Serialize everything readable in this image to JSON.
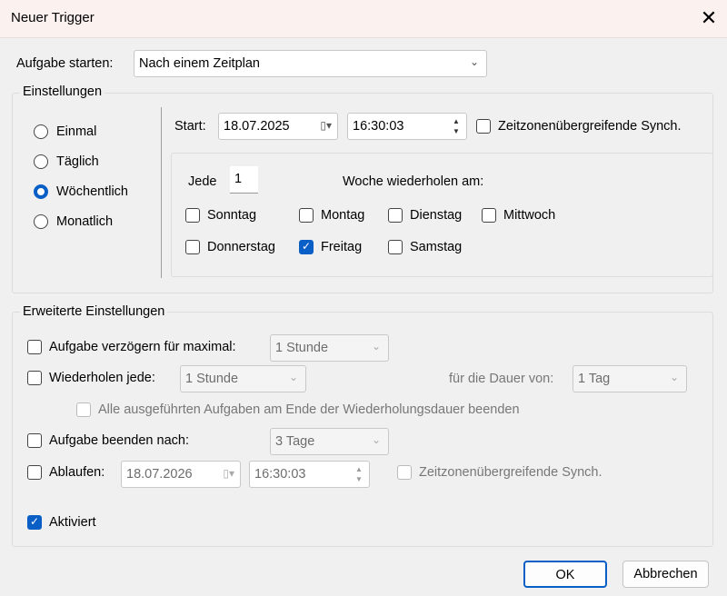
{
  "window": {
    "title": "Neuer Trigger",
    "close_icon": "close-icon"
  },
  "start_task": {
    "label": "Aufgabe starten:",
    "value": "Nach einem Zeitplan"
  },
  "settings": {
    "label": "Einstellungen",
    "schedules": [
      {
        "label": "Einmal",
        "selected": false
      },
      {
        "label": "Täglich",
        "selected": false
      },
      {
        "label": "Wöchentlich",
        "selected": true
      },
      {
        "label": "Monatlich",
        "selected": false
      }
    ],
    "start_label": "Start:",
    "start_date": "18.07.2025",
    "start_time": "16:30:03",
    "sync_label": "Zeitzonenübergreifende Synch.",
    "every_label": "Jede",
    "every_value": "1",
    "repeat_on_label": "Woche wiederholen am:",
    "days": [
      {
        "label": "Sonntag",
        "checked": false
      },
      {
        "label": "Montag",
        "checked": false
      },
      {
        "label": "Dienstag",
        "checked": false
      },
      {
        "label": "Mittwoch",
        "checked": false
      },
      {
        "label": "Donnerstag",
        "checked": false
      },
      {
        "label": "Freitag",
        "checked": true
      },
      {
        "label": "Samstag",
        "checked": false
      }
    ]
  },
  "advanced": {
    "label": "Erweiterte Einstellungen",
    "delay_label": "Aufgabe verzögern für maximal:",
    "delay_value": "1 Stunde",
    "repeat_label": "Wiederholen jede:",
    "repeat_value": "1 Stunde",
    "duration_label": "für die Dauer von:",
    "duration_value": "1 Tag",
    "stop_all_label": "Alle ausgeführten Aufgaben am Ende der Wiederholungsdauer beenden",
    "stop_after_label": "Aufgabe beenden nach:",
    "stop_after_value": "3 Tage",
    "expire_label": "Ablaufen:",
    "expire_date": "18.07.2026",
    "expire_time": "16:30:03",
    "expire_sync_label": "Zeitzonenübergreifende Synch.",
    "enabled_label": "Aktiviert"
  },
  "buttons": {
    "ok": "OK",
    "cancel": "Abbrechen"
  }
}
